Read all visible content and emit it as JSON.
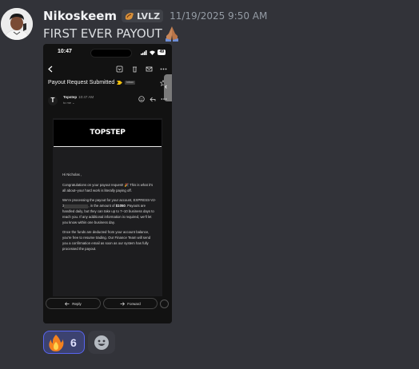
{
  "message": {
    "author": "Nikoskeem",
    "tag": "LVLZ",
    "tag_icon": "guild-tag-icon",
    "timestamp": "11/19/2025 9:50 AM",
    "text": "FIRST EVER PAYOUT",
    "emoji": "folded-hands-icon"
  },
  "attachment": {
    "status_time": "10:47",
    "battery": "49",
    "subject": "Payout Request Submitted",
    "label_chip": "Inbox",
    "sender": {
      "initial": "T",
      "name": "Topstep",
      "time": "10:47 AM",
      "to": "to me"
    },
    "logo": "TOPSTEP",
    "greeting": "Hi Nicholas ,",
    "para1": "Congratulations on your payout request! 🎉 This is what it's all about–your hard work is literally paying off.",
    "para2_a": "We're processing the payout for your account, EXPRESS-V2-3",
    "para2_b": ", in the amount of ",
    "amount": "$1050",
    "para2_c": ". Payouts are handled daily, but they can take up to 7–10 business days to reach you. If any additional information is required, we'll let you know within one business day.",
    "para3": "Once the funds are deducted from your account balance, you're free to resume trading. Our Finance Team will send you a confirmation email as soon as our system has fully processed the payout.",
    "reply_label": "Reply",
    "forward_label": "Forward"
  },
  "reactions": [
    {
      "emoji": "fire-icon",
      "count": "6",
      "active": true
    }
  ],
  "colors": {
    "background": "#323339",
    "reaction_active_bg": "#3c4270",
    "reaction_active_border": "#5865f2"
  }
}
